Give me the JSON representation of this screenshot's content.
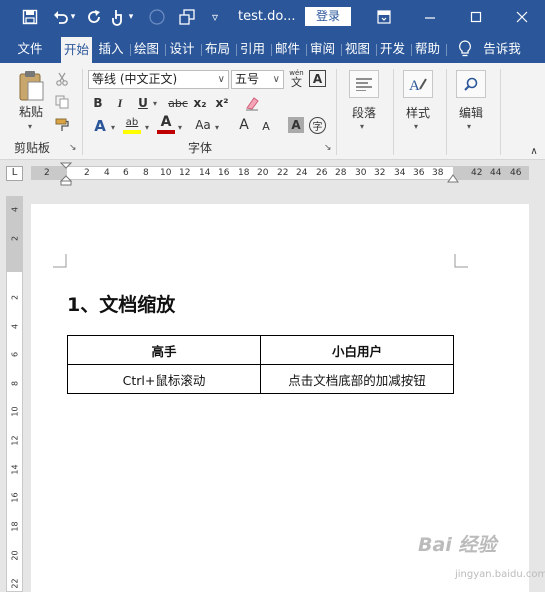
{
  "title_bar": {
    "doc_title": "test.do...",
    "login_label": "登录",
    "icons": [
      "save-icon",
      "undo-icon",
      "redo-icon",
      "touch-mode-icon",
      "circle-icon",
      "window-icon",
      "customize-icon",
      "ribbon-display-icon",
      "minimize-icon",
      "maximize-icon",
      "close-icon"
    ]
  },
  "tabs": [
    {
      "label": "文件"
    },
    {
      "label": "开始"
    },
    {
      "label": "插入"
    },
    {
      "label": "绘图"
    },
    {
      "label": "设计"
    },
    {
      "label": "布局"
    },
    {
      "label": "引用"
    },
    {
      "label": "邮件"
    },
    {
      "label": "审阅"
    },
    {
      "label": "视图"
    },
    {
      "label": "开发"
    },
    {
      "label": "帮助"
    },
    {
      "label": "告诉我"
    }
  ],
  "ribbon": {
    "clipboard": {
      "paste_label": "粘贴",
      "group_label": "剪贴板"
    },
    "font": {
      "font_name": "等线 (中文正文)",
      "font_size": "五号",
      "bold": "B",
      "italic": "I",
      "underline": "U",
      "strike": "abc",
      "subscript": "x₂",
      "superscript": "x²",
      "font_color_letter": "A",
      "highlight_letter": "ab",
      "case_label": "Aa",
      "grow_letter": "A",
      "shrink_letter": "A",
      "char_shading_letter": "A",
      "phonetic_top": "wén",
      "phonetic_letter": "文",
      "border_letter": "A",
      "enclose_letter": "字",
      "group_label": "字体"
    },
    "paragraph_label": "段落",
    "styles_label": "样式",
    "editing_label": "编辑"
  },
  "ruler": {
    "tab_selector": "L",
    "numbers": [
      "2",
      "2",
      "4",
      "6",
      "8",
      "10",
      "12",
      "14",
      "16",
      "18",
      "20",
      "22",
      "24",
      "26",
      "28",
      "30",
      "32",
      "34",
      "36",
      "38",
      "42",
      "44",
      "46"
    ],
    "vertical_numbers": [
      "4",
      "2",
      "2",
      "4",
      "6",
      "8",
      "10",
      "12",
      "14",
      "16",
      "18",
      "20",
      "22"
    ]
  },
  "document": {
    "heading": "1、文档缩放",
    "table": {
      "headers": [
        "高手",
        "小白用户"
      ],
      "rows": [
        [
          "Ctrl+鼠标滚动",
          "点击文档底部的加减按钮"
        ]
      ]
    }
  },
  "watermark": {
    "text": "Bai 经验",
    "sub": "jingyan.baidu.com"
  },
  "colors": {
    "accent": "#2b579a",
    "font_color": "#c00000",
    "highlight": "#ffff00"
  }
}
